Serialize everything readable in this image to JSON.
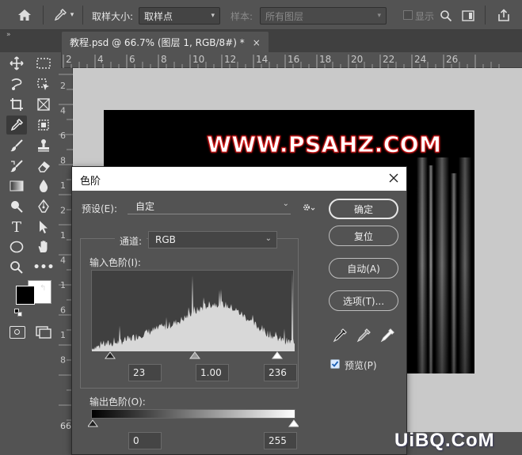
{
  "options_bar": {
    "sample_size_label": "取样大小:",
    "sample_size_value": "取样点",
    "sample_label": "样本:",
    "sample_value": "所有图层",
    "show_label": "显示"
  },
  "document": {
    "tab_title": "教程.psd @ 66.7% (图层 1, RGB/8#) *",
    "artwork_text": "WWW.PSAHZ.COM",
    "zoom_partial": "66"
  },
  "rulers": {
    "h_ticks": [
      "2",
      "4",
      "6",
      "8",
      "10",
      "12",
      "14",
      "16",
      "18",
      "20",
      "22",
      "24",
      "26"
    ],
    "v_ticks": [
      "2",
      "4",
      "6",
      "8",
      "1",
      "2",
      "1",
      "4",
      "1",
      "6",
      "1",
      "8"
    ]
  },
  "levels_dialog": {
    "title": "色阶",
    "preset_label": "预设(E):",
    "preset_value": "自定",
    "channel_label": "通道:",
    "channel_value": "RGB",
    "input_levels_label": "输入色阶(I):",
    "input_black": "23",
    "input_gamma": "1.00",
    "input_white": "236",
    "output_levels_label": "输出色阶(O):",
    "output_black": "0",
    "output_white": "255",
    "buttons": {
      "ok": "确定",
      "reset": "复位",
      "auto": "自动(A)",
      "options": "选项(T)..."
    },
    "preview_label": "预览(P)",
    "preview_checked": true
  },
  "watermark": "UiBQ.CoM"
}
